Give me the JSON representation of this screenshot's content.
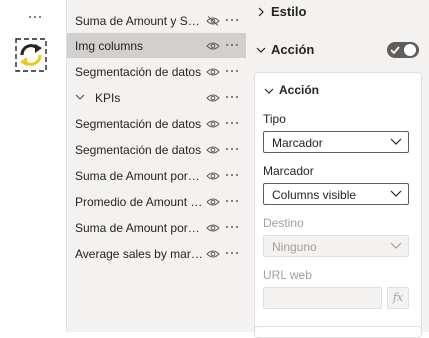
{
  "left_strip": {
    "more_icon": "more-horizontal-icon",
    "visual_icon": "refresh-bookmark-icon",
    "colors": {
      "accent_yellow": "#f2c811",
      "dark": "#252423"
    }
  },
  "layers": {
    "items": [
      {
        "label": "Suma de Amount y Sum of Target por Date",
        "type": "visual",
        "hidden": true,
        "selected": false
      },
      {
        "label": "Img columns",
        "type": "visual",
        "hidden": false,
        "selected": true
      },
      {
        "label": "Segmentación de datos",
        "type": "visual",
        "hidden": false,
        "selected": false
      },
      {
        "label": "KPIs",
        "type": "group",
        "hidden": false,
        "selected": false
      },
      {
        "label": "Segmentación de datos",
        "type": "visual",
        "hidden": false,
        "selected": false
      },
      {
        "label": "Segmentación de datos",
        "type": "visual",
        "hidden": false,
        "selected": false
      },
      {
        "label": "Suma de Amount por Date",
        "type": "visual",
        "hidden": false,
        "selected": false
      },
      {
        "label": "Promedio de Amount por Date",
        "type": "visual",
        "hidden": false,
        "selected": false
      },
      {
        "label": "Suma de Amount por Date",
        "type": "visual",
        "hidden": false,
        "selected": false
      },
      {
        "label": "Average sales by marital status",
        "type": "visual",
        "hidden": false,
        "selected": false
      }
    ]
  },
  "format_pane": {
    "estilo_title": "Estilo",
    "accion_title": "Acción",
    "accion_toggle_on": true,
    "card_title": "Acción",
    "tipo_label": "Tipo",
    "tipo_value": "Marcador",
    "marcador_label": "Marcador",
    "marcador_value": "Columns visible",
    "destino_label": "Destino",
    "destino_value": "Ninguno",
    "url_label": "URL web",
    "url_value": "",
    "fx_label": "fx"
  }
}
